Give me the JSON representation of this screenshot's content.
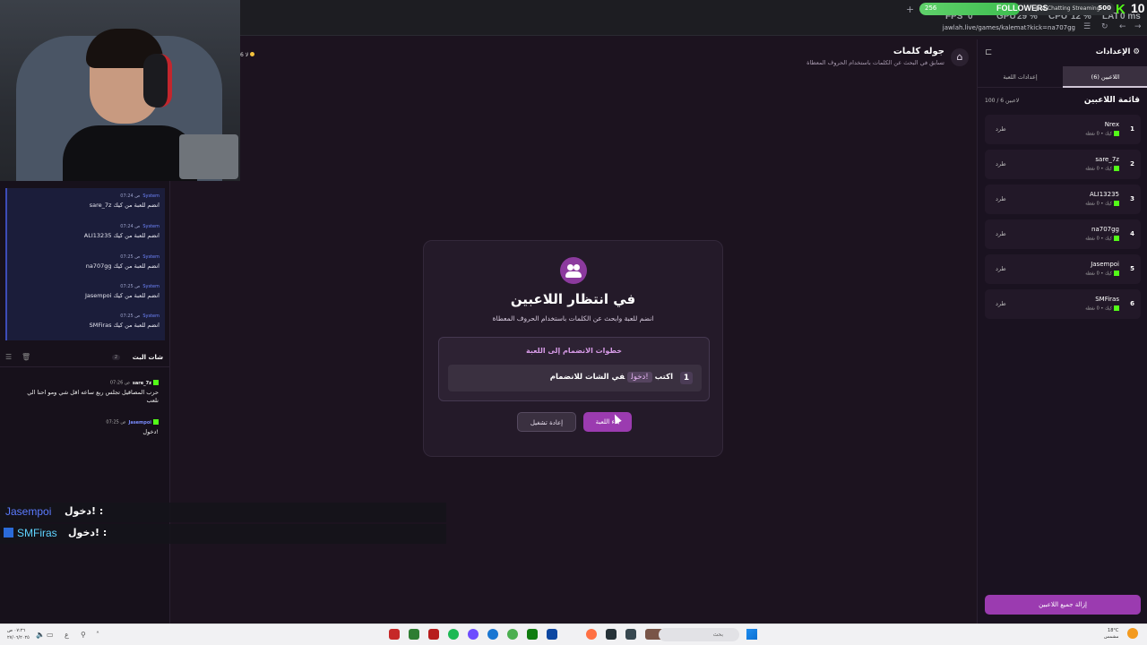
{
  "browser": {
    "url": "jawlah.live/games/kalemat?kick=na707gg",
    "new_tab": "+",
    "back": "←",
    "forward": "→",
    "reload": "↻",
    "menu": "☰"
  },
  "stream_overlay": {
    "fps_label": "FPS",
    "fps_value": "0",
    "gpu_label": "GPU",
    "gpu_value": "29 %",
    "cpu_label": "CPU",
    "cpu_value": "12 %",
    "lat_label": "LAT",
    "lat_value": "0 ms",
    "followers_label": "FOLLOWERS",
    "followers_count": "256",
    "followers_goal": "500",
    "followers_progress": 0.512,
    "category": "Just Chatting Streaming",
    "viewer_count": "10"
  },
  "system_log": [
    {
      "name": "System",
      "time": "07:24 ص",
      "text": "sare_7z انضم للعبة من كيك"
    },
    {
      "name": "System",
      "time": "07:24 ص",
      "text": "ALI13235 انضم للعبة من كيك"
    },
    {
      "name": "System",
      "time": "07:25 ص",
      "text": "na707gg انضم للعبة من كيك"
    },
    {
      "name": "System",
      "time": "07:25 ص",
      "text": "Jasempoi انضم للعبة من كيك"
    },
    {
      "name": "System",
      "time": "07:25 ص",
      "text": "SMFiras انضم للعبة من كيك"
    }
  ],
  "chat": {
    "title": "شات البث",
    "count": "2",
    "messages": [
      {
        "user": "sare_7z",
        "time": "07:26 ص",
        "text": "حرب المصاقيل تجلس ربع ساعه اقل شي ومو احنا الي نلعب"
      },
      {
        "user": "Jasempoi",
        "time": "07:25 ص",
        "text": "دخول!"
      }
    ]
  },
  "overlay_chat": [
    {
      "user": "Jasempoi",
      "text": "دخول! :",
      "color": "#5b7bff"
    },
    {
      "user": "SMFiras",
      "text": "دخول! :",
      "color": "#5fd3ff"
    }
  ],
  "header": {
    "title": "جوله كلمات",
    "subtitle": "تسابق في البحث عن الكلمات باستخدام الحروف المعطاة",
    "left_badge": "6 لا"
  },
  "modal": {
    "title": "في انتظار اللاعبين",
    "subtitle": "انضم للعبة وابحث عن الكلمات باستخدام الحروف المعطاة",
    "steps_title": "خطوات الانضمام إلى اللعبة",
    "step_number": "1",
    "step_prefix": "اكتب",
    "step_command": "!دخول",
    "step_suffix": "في الشات للانضمام",
    "start_label": "بدء اللعبة",
    "restart_label": "إعادة تشغيل"
  },
  "sidebar": {
    "title": "الإعدادات",
    "tab_players": "اللاعبين (6)",
    "tab_settings": "إعدادات اللعبة",
    "list_title": "قائمة اللاعبين",
    "list_count": "100 / 6 لاعبين",
    "kick_label": "طرد",
    "player_meta": "كيك • 0 نقطة",
    "players": [
      {
        "rank": "1",
        "name": "Nrex"
      },
      {
        "rank": "2",
        "name": "sare_7z"
      },
      {
        "rank": "3",
        "name": "ALI13235"
      },
      {
        "rank": "4",
        "name": "na707gg"
      },
      {
        "rank": "5",
        "name": "Jasempoi"
      },
      {
        "rank": "6",
        "name": "SMFiras"
      }
    ],
    "remove_all_label": "إزالة جميع اللاعبين"
  },
  "taskbar": {
    "time": "٠٧:٢٦ ص",
    "date": "٢٧/٠٦/٢٠٢٥",
    "search_placeholder": "بحث",
    "weather_temp": "18°C",
    "weather_desc": "مشمس"
  },
  "colors": {
    "accent": "#9b3bb0",
    "background": "#1c131f",
    "kick_green": "#53fc18"
  }
}
